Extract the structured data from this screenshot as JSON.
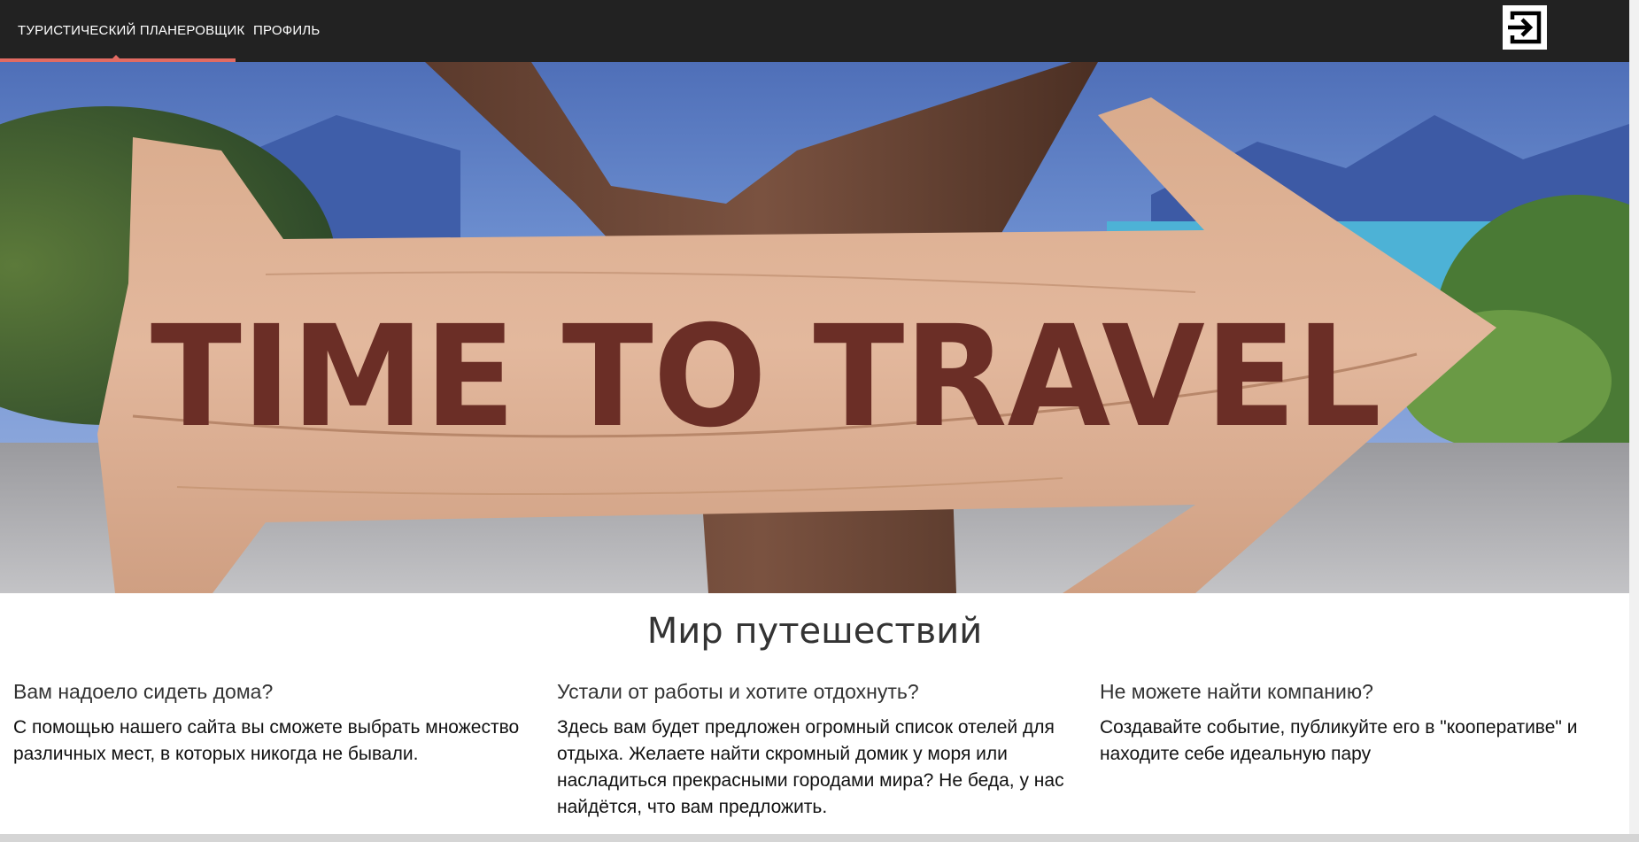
{
  "nav": {
    "home_label": "Туристический планеровщик",
    "profile_label": "Профиль",
    "active_color": "#e26b63",
    "logout_icon": "logout-icon"
  },
  "hero": {
    "sign_text": "TIME TO TRAVEL"
  },
  "main": {
    "title": "Мир путешествий",
    "columns": [
      {
        "heading": "Вам надоело сидеть дома?",
        "text": "С помощью нашего сайта вы сможете выбрать множество различных мест, в которых никогда не бывали."
      },
      {
        "heading": "Устали от работы и хотите отдохнуть?",
        "text": "Здесь вам будет предложен огромный список отелей для отдыха. Желаете найти скромный домик у моря или насладиться прекрасными городами мира? Не беда, у нас найдётся, что вам предложить."
      },
      {
        "heading": "Не можете найти компанию?",
        "text": "Создавайте событие, публикуйте его в \"кооперативе\" и находите себе идеальную пару"
      }
    ]
  }
}
